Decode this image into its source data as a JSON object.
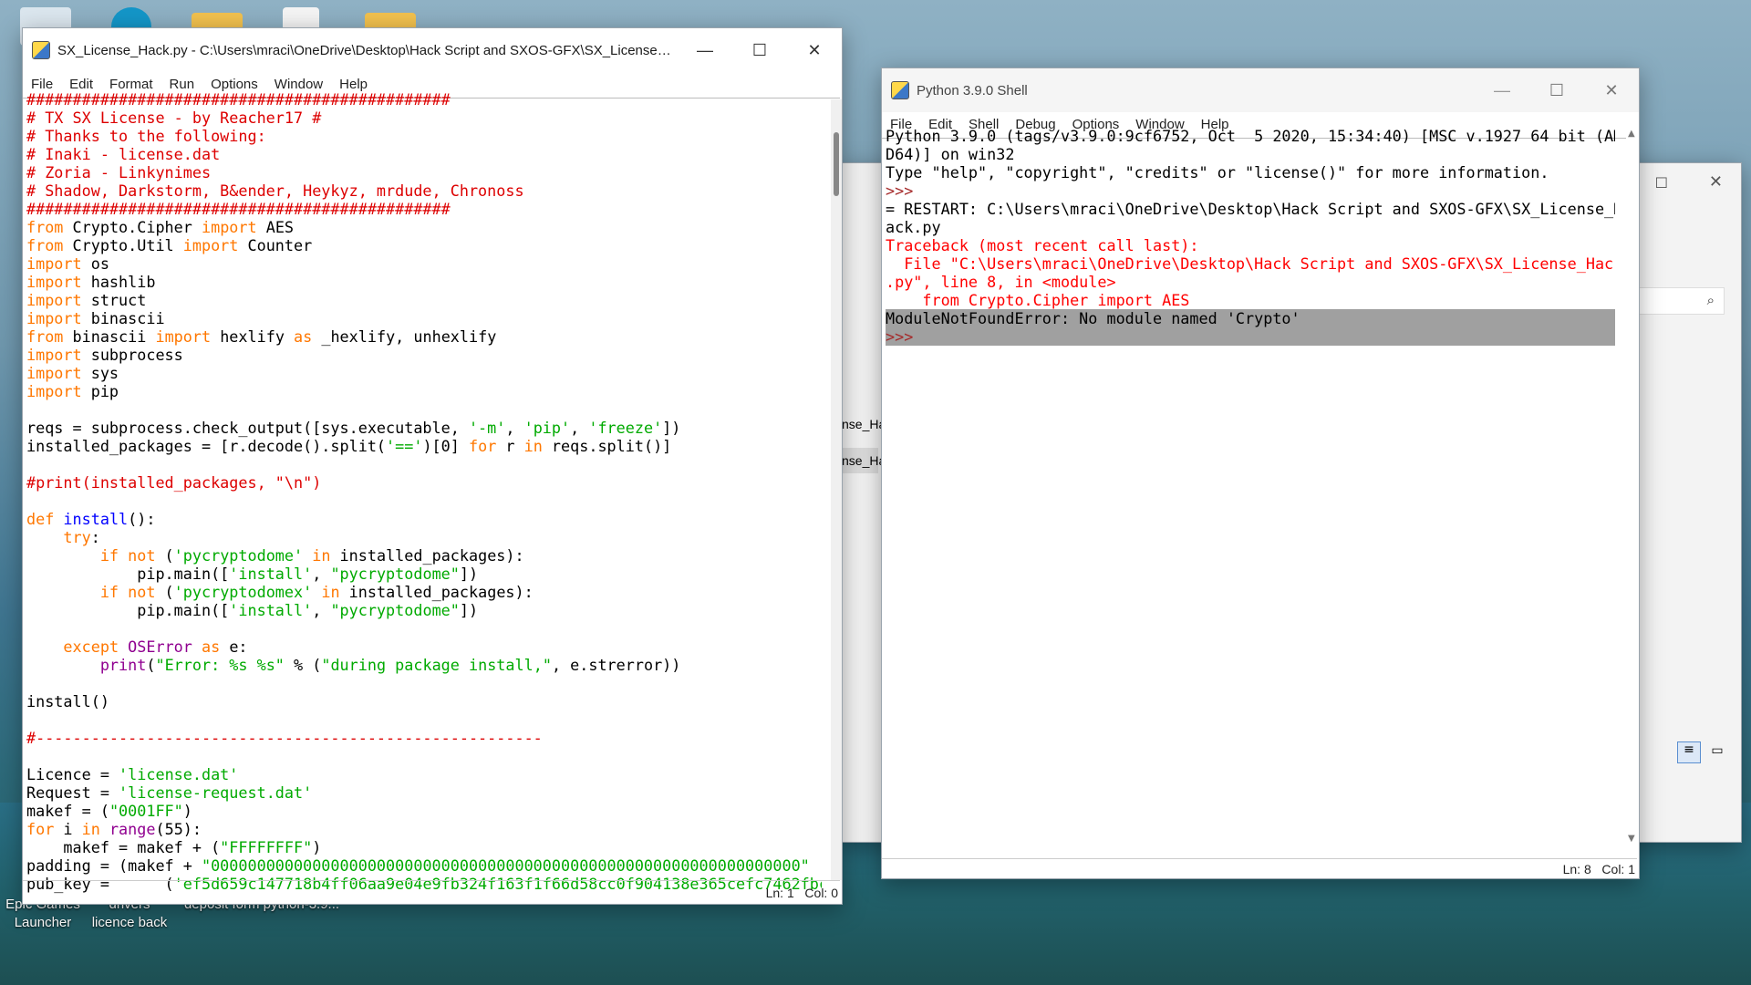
{
  "desktop": {
    "icon_labels": [
      {
        "text": "Epic Games\nLauncher"
      },
      {
        "text": "drivers\nlicence back"
      },
      {
        "text": "deposit form  python-3.9..."
      }
    ]
  },
  "editor": {
    "title": "SX_License_Hack.py - C:\\Users\\mraci\\OneDrive\\Desktop\\Hack Script and SXOS-GFX\\SX_License_Hack....",
    "menu": [
      "File",
      "Edit",
      "Format",
      "Run",
      "Options",
      "Window",
      "Help"
    ],
    "status": "Ln: 1   Col: 0"
  },
  "shell": {
    "title": "Python 3.9.0 Shell",
    "menu": [
      "File",
      "Edit",
      "Shell",
      "Debug",
      "Options",
      "Window",
      "Help"
    ],
    "status": "Ln: 8   Col: 1"
  },
  "background_window": {
    "partial_labels": [
      "nse_Ha",
      "nse_Ha"
    ]
  },
  "colors": {
    "keyword": "#ff7700",
    "comment": "#dd0000",
    "string": "#00aa00",
    "builtin": "#900090",
    "function": "#0000ff",
    "error": "#ff0000",
    "highlight": "#a0a0a0"
  },
  "icons": [
    "python-file-icon",
    "minimize-icon",
    "maximize-icon",
    "close-icon",
    "search-icon",
    "list-view-icon",
    "tile-view-icon"
  ]
}
